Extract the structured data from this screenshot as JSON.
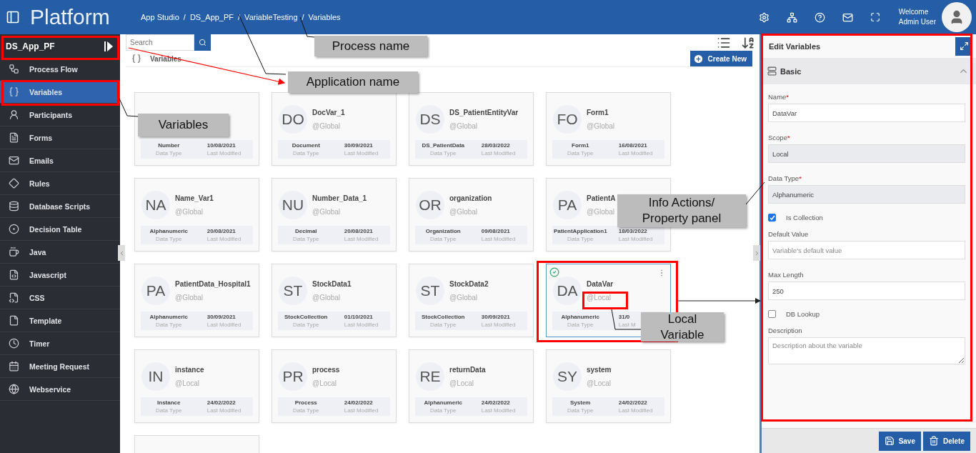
{
  "header": {
    "logo": "Platform",
    "breadcrumbs": [
      "App Studio",
      "DS_App_PF",
      "VariableTesting",
      "Variables"
    ],
    "separator": "/",
    "welcome": "Welcome",
    "user": "Admin User"
  },
  "sidebar": {
    "app_name": "DS_App_PF",
    "items": [
      {
        "label": "Process Flow",
        "selected": false
      },
      {
        "label": "Variables",
        "selected": true
      },
      {
        "label": "Participants",
        "selected": false
      },
      {
        "label": "Forms",
        "selected": false
      },
      {
        "label": "Emails",
        "selected": false
      },
      {
        "label": "Rules",
        "selected": false
      },
      {
        "label": "Database Scripts",
        "selected": false
      },
      {
        "label": "Decision Table",
        "selected": false
      },
      {
        "label": "Java",
        "selected": false
      },
      {
        "label": "Javascript",
        "selected": false
      },
      {
        "label": "CSS",
        "selected": false
      },
      {
        "label": "Template",
        "selected": false
      },
      {
        "label": "Timer",
        "selected": false
      },
      {
        "label": "Meeting Request",
        "selected": false
      },
      {
        "label": "Webservice",
        "selected": false
      }
    ]
  },
  "toolbar": {
    "search": {
      "placeholder": "Search"
    },
    "section_title": "Variables",
    "create_button": "Create New"
  },
  "cards": [
    {
      "kind": "variable",
      "data_type": "Number",
      "data_type_label": "Data Type",
      "modified": "10/08/2021",
      "modified_label": "Last Modified",
      "selected": false
    },
    {
      "kind": "variable",
      "initials": "DO",
      "name": "DocVar_1",
      "scope": "@Global",
      "data_type": "Document",
      "data_type_label": "Data Type",
      "modified": "30/09/2021",
      "modified_label": "Last Modified",
      "selected": false
    },
    {
      "kind": "variable",
      "initials": "DS",
      "name": "DS_PatientEntityVar",
      "scope": "@Global",
      "data_type": "DS_PatientData",
      "data_type_label": "Data Type",
      "modified": "28/03/2022",
      "modified_label": "Last Modified",
      "selected": false
    },
    {
      "kind": "variable",
      "initials": "FO",
      "name": "Form1",
      "scope": "@Global",
      "data_type": "Form1",
      "data_type_label": "Data Type",
      "modified": "16/08/2021",
      "modified_label": "Last Modified",
      "selected": false
    },
    {
      "kind": "variable",
      "initials": "NA",
      "name": "Name_Var1",
      "scope": "@Global",
      "data_type": "Alphanumeric",
      "data_type_label": "Data Type",
      "modified": "20/08/2021",
      "modified_label": "Last Modified",
      "selected": false
    },
    {
      "kind": "variable",
      "initials": "NU",
      "name": "Number_Data_1",
      "scope": "@Global",
      "data_type": "Decimal",
      "data_type_label": "Data Type",
      "modified": "20/08/2021",
      "modified_label": "Last Modified",
      "selected": false
    },
    {
      "kind": "variable",
      "initials": "OR",
      "name": "organization",
      "scope": "@Global",
      "data_type": "Organization",
      "data_type_label": "Data Type",
      "modified": "09/08/2021",
      "modified_label": "Last Modified",
      "selected": false
    },
    {
      "kind": "variable",
      "initials": "PA",
      "name": "PatientA",
      "scope": "@Global",
      "data_type": "PatientApplication1",
      "data_type_label": "Data Type",
      "modified": "18/03/2022",
      "modified_label": "Last Modified",
      "selected": false
    },
    {
      "kind": "variable",
      "initials": "PA",
      "name": "PatientData_Hospital1",
      "scope": "@Global",
      "data_type": "Alphanumeric",
      "data_type_label": "Data Type",
      "modified": "30/09/2021",
      "modified_label": "Last Modified",
      "selected": false
    },
    {
      "kind": "variable",
      "initials": "ST",
      "name": "StockData1",
      "scope": "@Global",
      "data_type": "StockCollection",
      "data_type_label": "Data Type",
      "modified": "01/10/2021",
      "modified_label": "Last Modified",
      "selected": false
    },
    {
      "kind": "variable",
      "initials": "ST",
      "name": "StockData2",
      "scope": "@Global",
      "data_type": "StockCollection",
      "data_type_label": "Data Type",
      "modified": "30/09/2021",
      "modified_label": "Last Modified",
      "selected": false
    },
    {
      "kind": "variable",
      "initials": "DA",
      "name": "DataVar",
      "scope": "@Local",
      "data_type": "Alphanumeric",
      "data_type_label": "Data Type",
      "modified": "31/0",
      "modified_label": "Last M",
      "selected": true
    },
    {
      "kind": "variable",
      "initials": "IN",
      "name": "instance",
      "scope": "@Local",
      "data_type": "Instance",
      "data_type_label": "Data Type",
      "modified": "24/02/2022",
      "modified_label": "Last Modified",
      "selected": false
    },
    {
      "kind": "variable",
      "initials": "PR",
      "name": "process",
      "scope": "@Local",
      "data_type": "Process",
      "data_type_label": "Data Type",
      "modified": "24/02/2022",
      "modified_label": "Last Modified",
      "selected": false
    },
    {
      "kind": "variable",
      "initials": "RE",
      "name": "returnData",
      "scope": "@Local",
      "data_type": "Alphanumeric",
      "data_type_label": "Data Type",
      "modified": "24/02/2022",
      "modified_label": "Last Modified",
      "selected": false
    },
    {
      "kind": "variable",
      "initials": "SY",
      "name": "system",
      "scope": "@Local",
      "data_type": "System",
      "data_type_label": "Data Type",
      "modified": "24/02/2022",
      "modified_label": "Last Modified",
      "selected": false
    },
    {
      "kind": "cut"
    }
  ],
  "panel": {
    "title": "Edit Variables",
    "required_mark": "*",
    "section": "Basic",
    "expanded": true,
    "fields": [
      {
        "kind": "text",
        "label": "Name",
        "required": true,
        "value": "DataVar",
        "disabled": false
      },
      {
        "kind": "text",
        "label": "Scope",
        "required": true,
        "value": "Local",
        "disabled": true
      },
      {
        "kind": "text",
        "label": "Data Type",
        "required": true,
        "value": "Alphanumeric",
        "disabled": true
      },
      {
        "kind": "checkbox",
        "label": "Is Collection",
        "checked": true
      },
      {
        "kind": "text",
        "label": "Default Value",
        "required": false,
        "placeholder": "Variable's default value",
        "disabled": false
      },
      {
        "kind": "text",
        "label": "Max Length",
        "required": false,
        "value": "250",
        "disabled": false
      },
      {
        "kind": "checkbox",
        "label": "DB Lookup",
        "checked": false
      },
      {
        "kind": "textarea",
        "label": "Description",
        "required": false,
        "placeholder": "Description about the variable"
      }
    ],
    "buttons": [
      {
        "kind": "save",
        "label": "Save"
      },
      {
        "kind": "delete",
        "label": "Delete"
      }
    ]
  },
  "callouts": [
    {
      "text": "Process name"
    },
    {
      "text": "Application name"
    },
    {
      "text": "Variables"
    },
    {
      "text": "Info Actions/ Property panel"
    },
    {
      "text": "Local Variable"
    }
  ]
}
